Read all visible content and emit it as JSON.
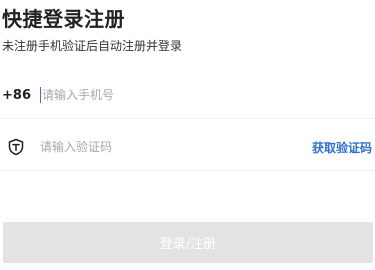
{
  "header": {
    "title": "快捷登录注册",
    "subtitle": "未注册手机验证后自动注册并登录"
  },
  "phone": {
    "country_code": "+86",
    "placeholder": "请输入手机号",
    "value": ""
  },
  "verification": {
    "icon": "shield-t-icon",
    "placeholder": "请输入验证码",
    "value": "",
    "get_code_label": "获取验证码"
  },
  "submit": {
    "label": "登录/注册",
    "enabled": false
  },
  "colors": {
    "accent": "#2f6fd0",
    "caret": "#3b6fd6",
    "button_disabled": "#e3e3e3",
    "placeholder": "#a8a8a8"
  }
}
